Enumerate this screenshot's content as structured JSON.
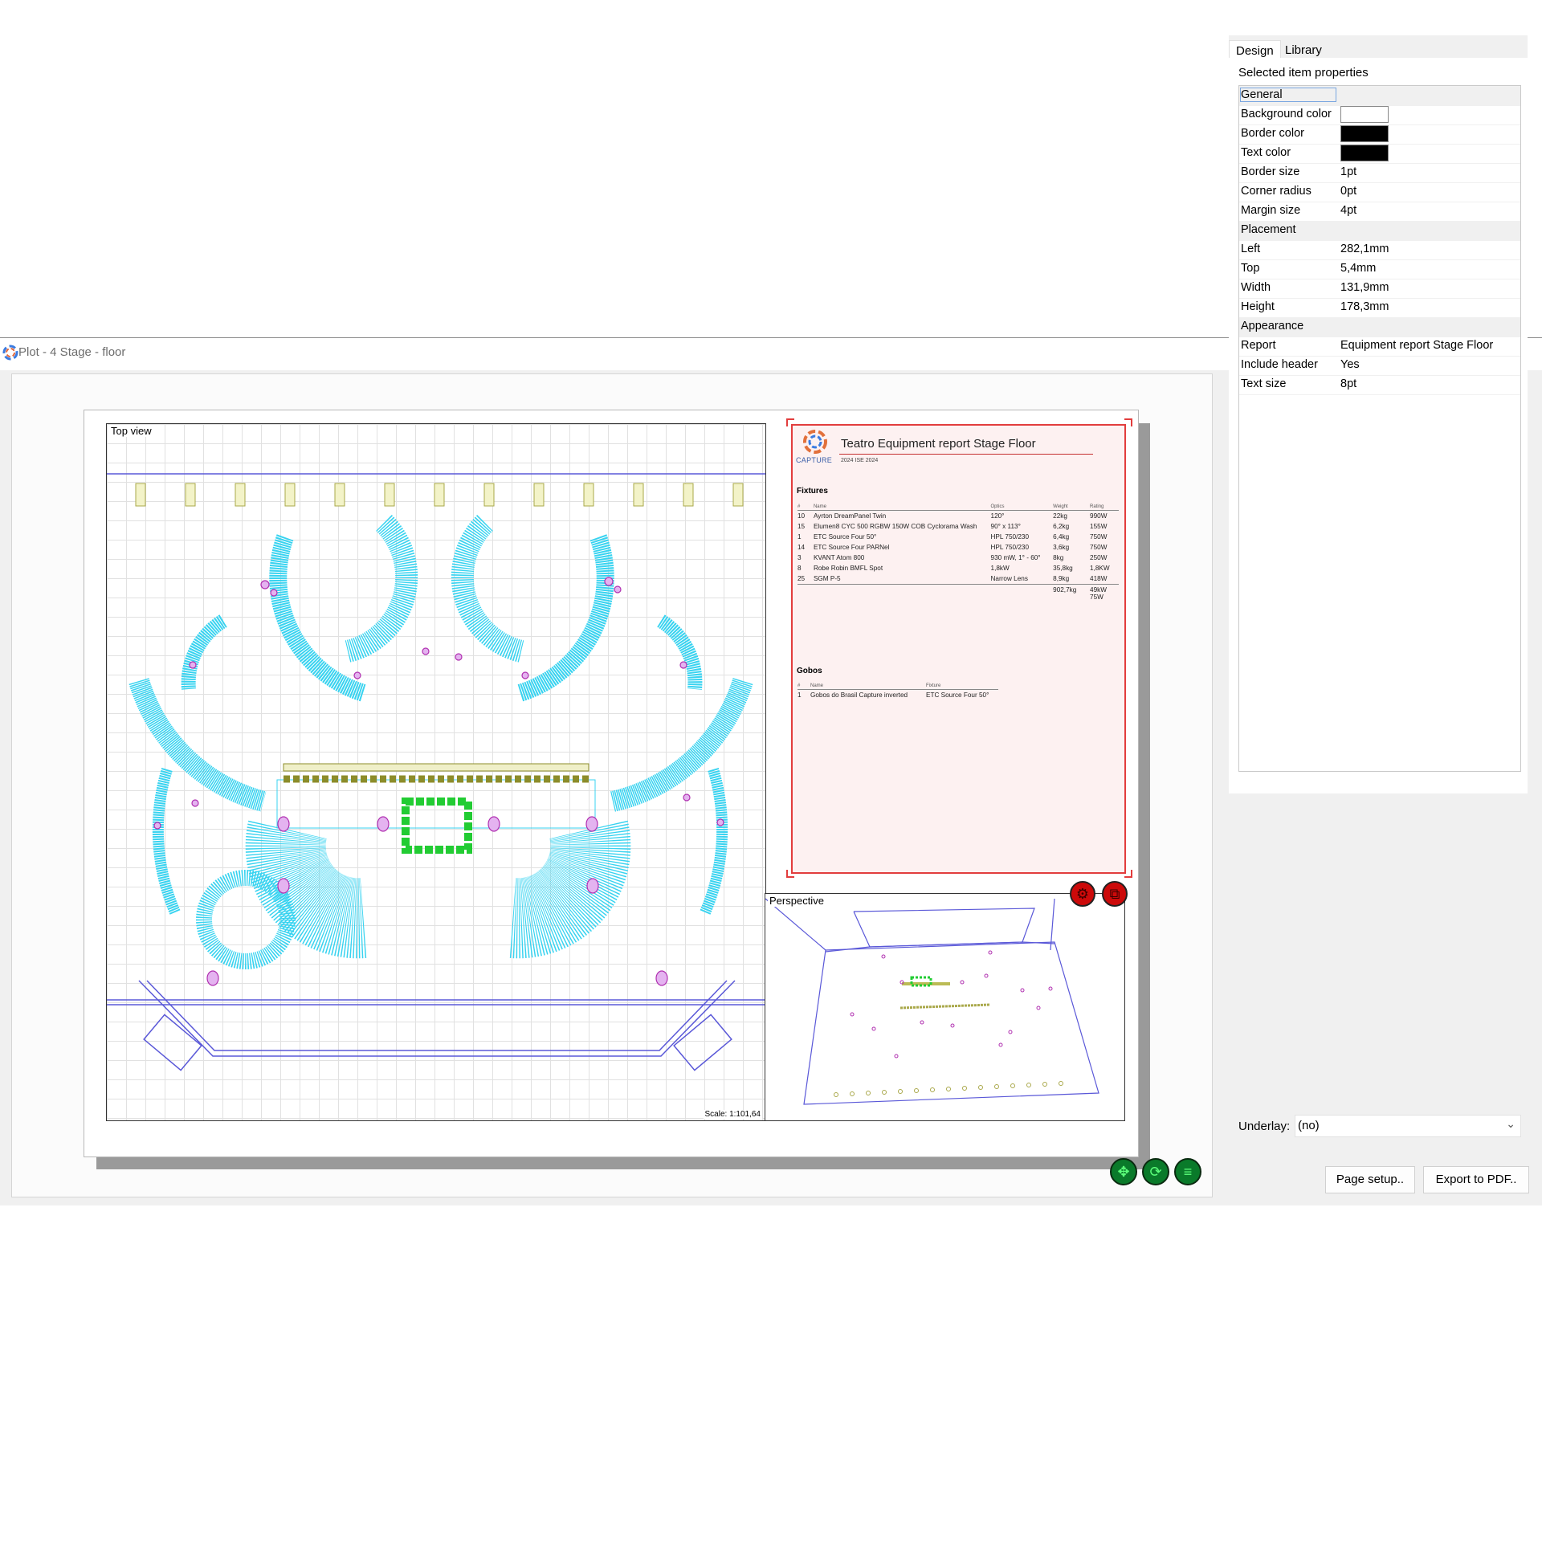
{
  "window": {
    "title": "Plot - 4 Stage - floor",
    "minimize": "—",
    "restore": "❐",
    "close": "✕"
  },
  "views": {
    "top_view_label": "Top view",
    "scale": "Scale: 1:101,64",
    "perspective_label": "Perspective"
  },
  "report": {
    "title": "Teatro Equipment report Stage Floor",
    "subtitle": "2024 ISE 2024",
    "logo_text": "CAPTURE",
    "fixtures_heading": "Fixtures",
    "fixtures_headers": [
      "#",
      "Name",
      "Optics",
      "Weight",
      "Rating"
    ],
    "fixtures": [
      [
        "10",
        "Ayrton DreamPanel Twin",
        "120°",
        "22kg",
        "990W"
      ],
      [
        "15",
        "Elumen8 CYC 500 RGBW 150W COB Cyclorama Wash",
        "90° x 113°",
        "6,2kg",
        "155W"
      ],
      [
        "1",
        "ETC Source Four 50°",
        "HPL 750/230",
        "6,4kg",
        "750W"
      ],
      [
        "14",
        "ETC Source Four PARNel",
        "HPL 750/230",
        "3,6kg",
        "750W"
      ],
      [
        "3",
        "KVANT Atom 800",
        "930 mW, 1° - 60°",
        "8kg",
        "250W"
      ],
      [
        "8",
        "Robe Robin BMFL Spot",
        "1,8kW",
        "35,8kg",
        "1,8KW"
      ],
      [
        "25",
        "SGM P-5",
        "Narrow Lens",
        "8,9kg",
        "418W"
      ]
    ],
    "fixtures_total_weight": "902,7kg",
    "fixtures_total_rating": "49kW 75W",
    "gobos_heading": "Gobos",
    "gobos_headers": [
      "#",
      "Name",
      "Fixture"
    ],
    "gobos": [
      [
        "1",
        "Gobos do Brasil Capture inverted",
        "ETC Source Four 50°"
      ]
    ]
  },
  "side": {
    "tabs": [
      "Design",
      "Library"
    ],
    "section_title": "Selected item properties",
    "properties": [
      {
        "type": "category",
        "key": "General"
      },
      {
        "type": "swatch",
        "key": "Background color",
        "color": "#ffffff"
      },
      {
        "type": "swatch",
        "key": "Border color",
        "color": "#000000"
      },
      {
        "type": "swatch",
        "key": "Text color",
        "color": "#000000"
      },
      {
        "type": "value",
        "key": "Border size",
        "value": "1pt"
      },
      {
        "type": "value",
        "key": "Corner radius",
        "value": "0pt"
      },
      {
        "type": "value",
        "key": "Margin size",
        "value": "4pt"
      },
      {
        "type": "category",
        "key": "Placement"
      },
      {
        "type": "value",
        "key": "Left",
        "value": "282,1mm"
      },
      {
        "type": "value",
        "key": "Top",
        "value": "5,4mm"
      },
      {
        "type": "value",
        "key": "Width",
        "value": "131,9mm"
      },
      {
        "type": "value",
        "key": "Height",
        "value": "178,3mm"
      },
      {
        "type": "category",
        "key": "Appearance"
      },
      {
        "type": "value",
        "key": "Report",
        "value": "Equipment report Stage Floor"
      },
      {
        "type": "value",
        "key": "Include header",
        "value": "Yes"
      },
      {
        "type": "value",
        "key": "Text size",
        "value": "8pt"
      }
    ],
    "underlay_label": "Underlay:",
    "underlay_value": "(no)",
    "page_setup_button": "Page setup..",
    "export_button": "Export to PDF.."
  },
  "icons": {
    "settings": "gear-icon",
    "copy": "copy-icon",
    "move": "move-icon",
    "refresh": "refresh-icon",
    "menu": "menu-icon"
  },
  "colors": {
    "report_border": "#e23d3d",
    "truss": "#38d3f0",
    "fixture_magenta": "#b02fb0",
    "fixture_green": "#22cc33",
    "stage_outline": "#5a58d8",
    "action_red": "#cc0a0a",
    "action_green": "#0a7a2a"
  }
}
